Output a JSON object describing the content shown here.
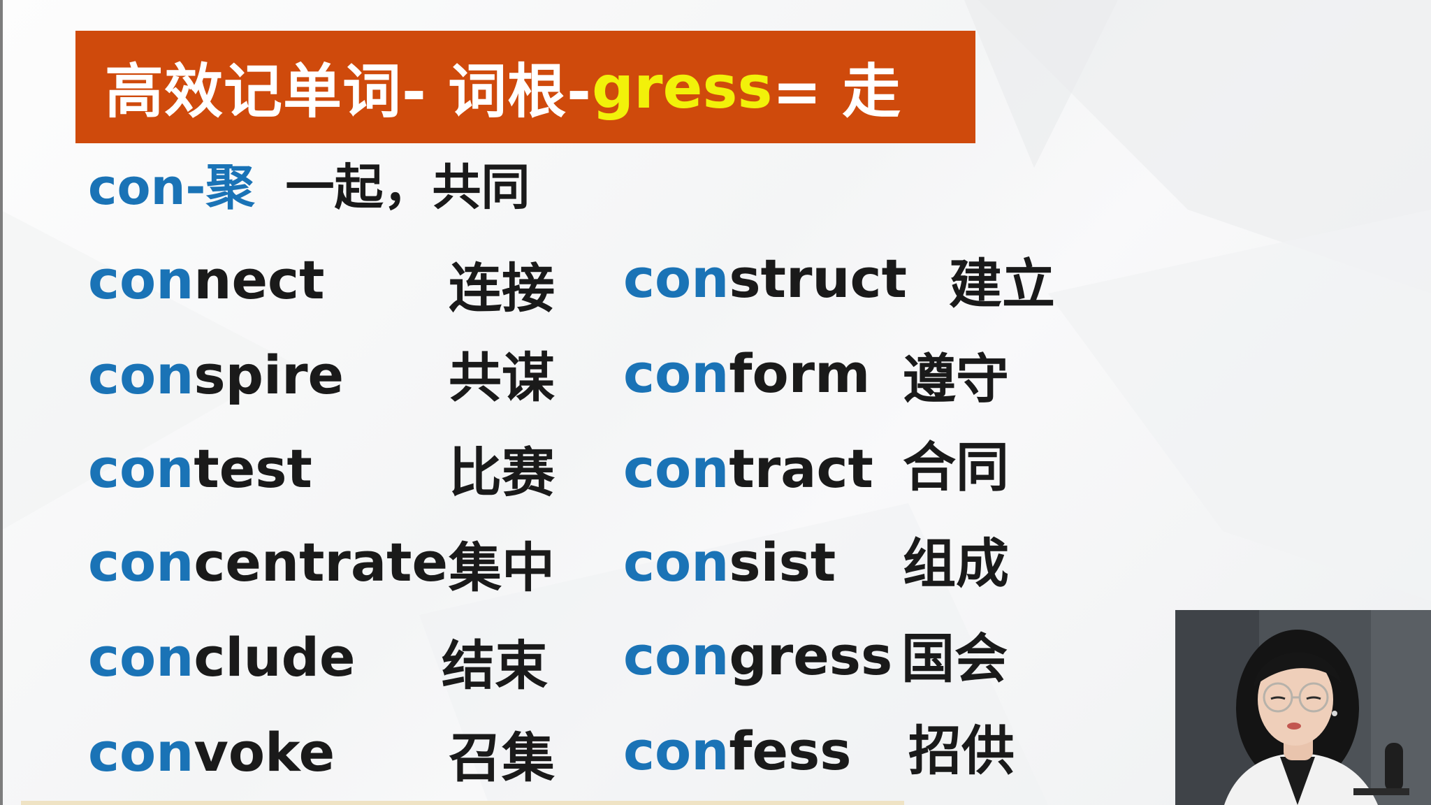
{
  "banner": {
    "title_prefix": "高效记单词- 词根- ",
    "title_root": "gress",
    "title_suffix": " = 走",
    "background_color": "#cf4a0c",
    "root_color": "#f2f10a"
  },
  "prefix": {
    "label": "con-聚",
    "meaning": "一起，共同",
    "color": "#1a73b6"
  },
  "words": [
    {
      "prefix": "con",
      "rest": "nect",
      "meaning": "连接"
    },
    {
      "prefix": "con",
      "rest": "spire",
      "meaning": "共谋"
    },
    {
      "prefix": "con",
      "rest": "test",
      "meaning": "比赛"
    },
    {
      "prefix": "con",
      "rest": "centrate",
      "meaning": "集中"
    },
    {
      "prefix": "con",
      "rest": "clude",
      "meaning": "结束"
    },
    {
      "prefix": "con",
      "rest": "voke",
      "meaning": "召集"
    },
    {
      "prefix": "con",
      "rest": "struct",
      "meaning": "建立"
    },
    {
      "prefix": "con",
      "rest": "form",
      "meaning": "遵守"
    },
    {
      "prefix": "con",
      "rest": "tract",
      "meaning": "合同"
    },
    {
      "prefix": "con",
      "rest": "sist",
      "meaning": "组成"
    },
    {
      "prefix": "con",
      "rest": "gress",
      "meaning": "国会"
    },
    {
      "prefix": "con",
      "rest": "fess",
      "meaning": "招供"
    }
  ],
  "webcam": {
    "background_color": "#4a4f54"
  }
}
